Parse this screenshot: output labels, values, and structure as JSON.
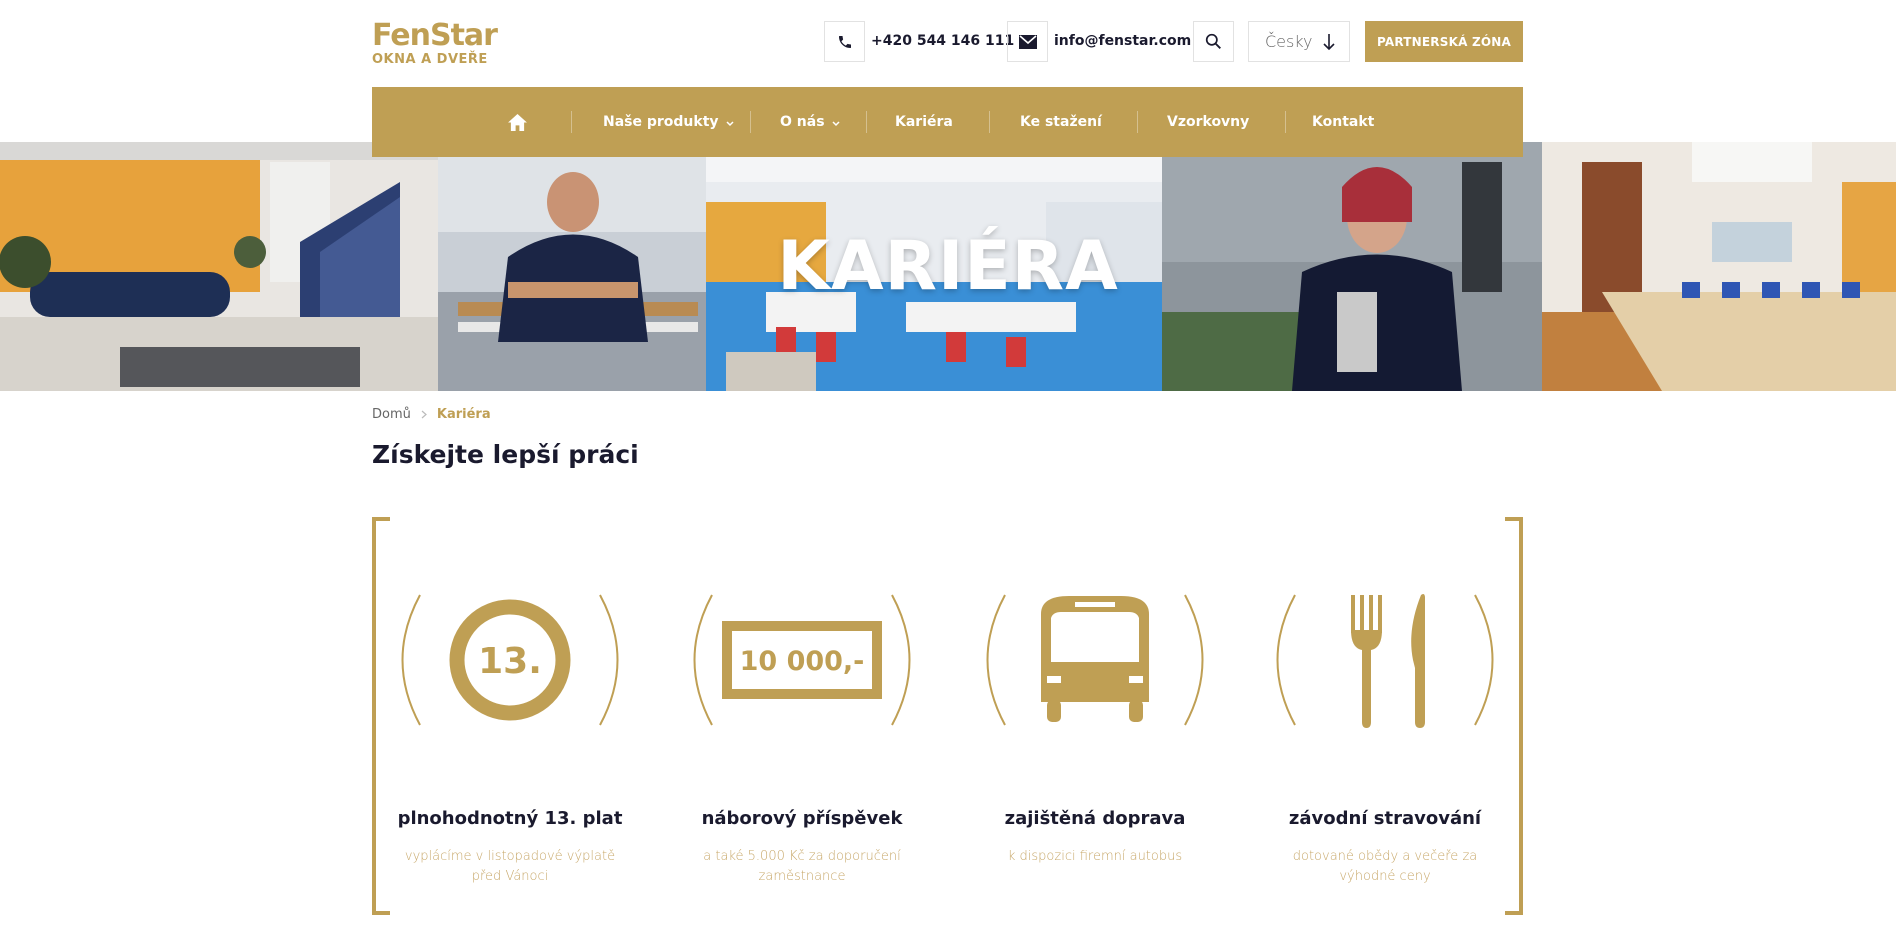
{
  "brand": {
    "name": "FenStar",
    "tagline": "OKNA A DVEŘE",
    "accent": "#bf9f54"
  },
  "header": {
    "phone": "+420 544 146 111",
    "email": "info@fenstar.com",
    "language": "Česky",
    "partner_button": "PARTNERSKÁ ZÓNA"
  },
  "nav": {
    "items": [
      {
        "label": "Naše produkty"
      },
      {
        "label": "O nás"
      },
      {
        "label": "Kariéra"
      },
      {
        "label": "Ke stažení"
      },
      {
        "label": "Vzorkovny"
      },
      {
        "label": "Kontakt"
      }
    ]
  },
  "hero": {
    "title": "KARIÉRA"
  },
  "breadcrumb": {
    "home": "Domů",
    "current": "Kariéra"
  },
  "page": {
    "heading": "Získejte lepší práci"
  },
  "benefits": [
    {
      "icon": "badge-13-icon",
      "icon_text": "13.",
      "title": "plnohodnotný 13. plat",
      "desc": "vyplácíme v listopadové výplatě před Vánoci"
    },
    {
      "icon": "banknote-icon",
      "icon_text": "10 000,-",
      "title": "náborový příspěvek",
      "desc": "a také 5.000 Kč za doporučení zaměstnance"
    },
    {
      "icon": "bus-icon",
      "title": "zajištěná doprava",
      "desc": "k dispozici firemní autobus"
    },
    {
      "icon": "fork-knife-icon",
      "title": "závodní stravování",
      "desc": "dotované obědy a večeře za výhodné ceny"
    }
  ]
}
